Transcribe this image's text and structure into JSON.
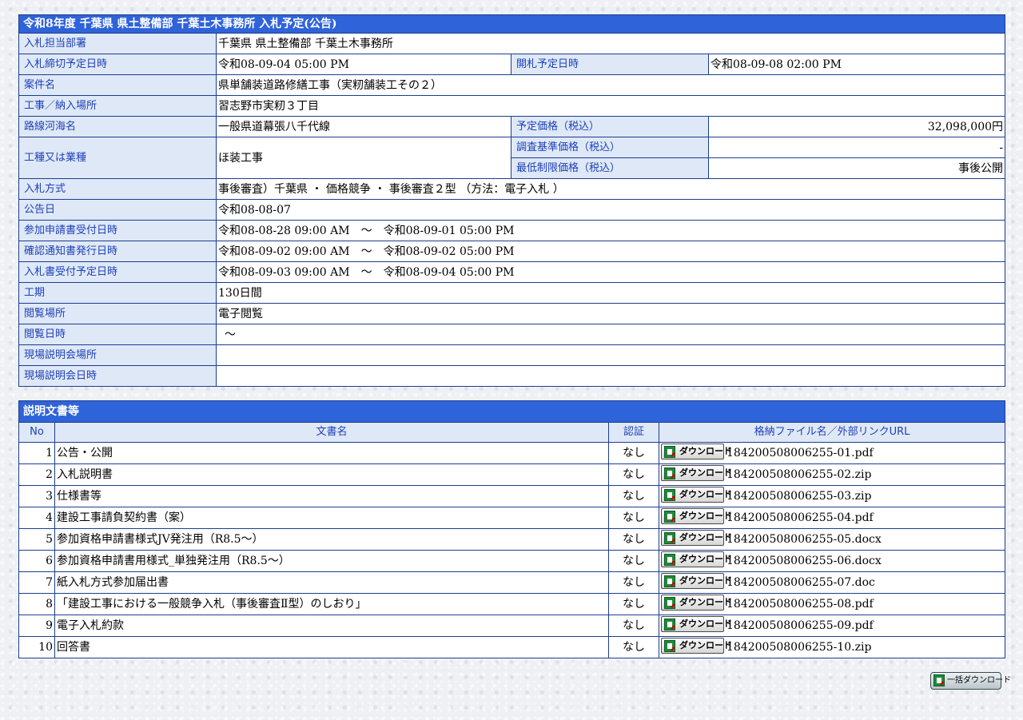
{
  "header": {
    "title": "令和8年度 千葉県 県土整備部 千葉土木事務所 入札予定(公告)"
  },
  "info": {
    "dept_label": "入札担当部署",
    "dept": "千葉県 県土整備部 千葉土木事務所",
    "deadline_label": "入札締切予定日時",
    "deadline": "令和08-09-04 05:00 PM",
    "opening_label": "開札予定日時",
    "opening": "令和08-09-08 02:00 PM",
    "case_label": "案件名",
    "case": "県単舗装道路修繕工事（実籾舗装工その２）",
    "place_label": "工事／納入場所",
    "place": "習志野市実籾３丁目",
    "route_label": "路線河海名",
    "route": "一般県道幕張八千代線",
    "price_label": "予定価格（税込）",
    "price": "32,098,000円",
    "type_label": "工種又は業種",
    "type": "ほ装工事",
    "survey_label": "調査基準価格（税込）",
    "survey": "-",
    "min_label": "最低制限価格（税込）",
    "min": "事後公開",
    "method_label": "入札方式",
    "method": "事後審査）千葉県 ・ 価格競争 ・ 事後審査２型 （方法：電子入札 ）",
    "notice_label": "公告日",
    "notice": "令和08-08-07",
    "apply_label": "参加申請書受付日時",
    "apply": "令和08-08-28 09:00 AM　～　令和08-09-01 05:00 PM",
    "confirm_label": "確認通知書発行日時",
    "confirm": "令和08-09-02 09:00 AM　～　令和08-09-02 05:00 PM",
    "bid_label": "入札書受付予定日時",
    "bid": "令和08-09-03 09:00 AM　～　令和08-09-04 05:00 PM",
    "period_label": "工期",
    "period": "130日間",
    "view_place_label": "閲覧場所",
    "view_place": "電子閲覧",
    "view_date_label": "閲覧日時",
    "view_date": "～",
    "site_place_label": "現場説明会場所",
    "site_place": "",
    "site_date_label": "現場説明会日時",
    "site_date": ""
  },
  "docs": {
    "title": "説明文書等",
    "headers": {
      "no": "No",
      "name": "文書名",
      "auth": "認証",
      "file": "格納ファイル名／外部リンクURL"
    },
    "download_label": "ダウンロード",
    "rows": [
      {
        "no": "1",
        "name": "公告・公開",
        "auth": "なし",
        "file": "184200508006255-01.pdf"
      },
      {
        "no": "2",
        "name": "入札説明書",
        "auth": "なし",
        "file": "184200508006255-02.zip"
      },
      {
        "no": "3",
        "name": "仕様書等",
        "auth": "なし",
        "file": "184200508006255-03.zip"
      },
      {
        "no": "4",
        "name": "建設工事請負契約書（案）",
        "auth": "なし",
        "file": "184200508006255-04.pdf"
      },
      {
        "no": "5",
        "name": "参加資格申請書様式JV発注用（R8.5～）",
        "auth": "なし",
        "file": "184200508006255-05.docx"
      },
      {
        "no": "6",
        "name": "参加資格申請書用様式_単独発注用（R8.5～）",
        "auth": "なし",
        "file": "184200508006255-06.docx"
      },
      {
        "no": "7",
        "name": "紙入札方式参加届出書",
        "auth": "なし",
        "file": "184200508006255-07.doc"
      },
      {
        "no": "8",
        "name": "「建設工事における一般競争入札（事後審査Ⅱ型）のしおり」",
        "auth": "なし",
        "file": "184200508006255-08.pdf"
      },
      {
        "no": "9",
        "name": "電子入札約款",
        "auth": "なし",
        "file": "184200508006255-09.pdf"
      },
      {
        "no": "10",
        "name": "回答書",
        "auth": "なし",
        "file": "184200508006255-10.zip"
      }
    ]
  },
  "bulk_download_label": "一括ダウンロード"
}
